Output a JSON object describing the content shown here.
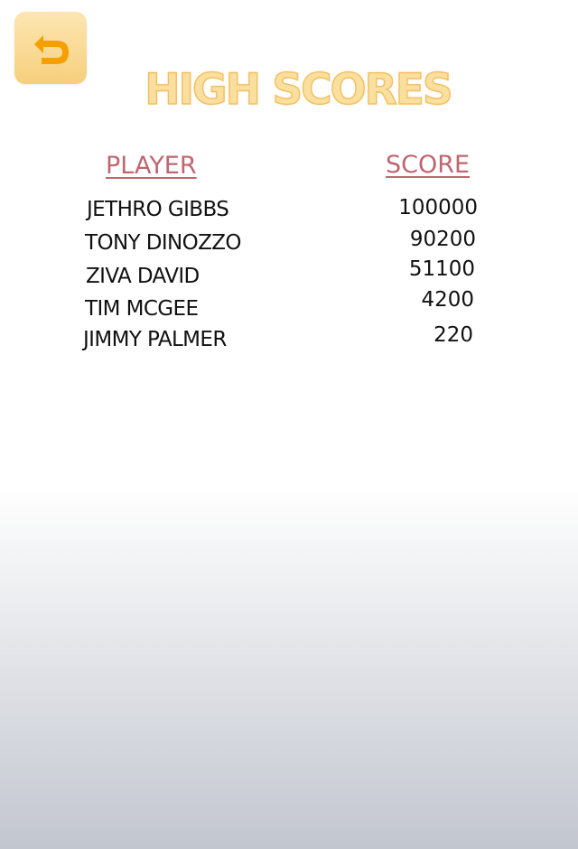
{
  "header": {
    "title": "HIGH SCORES",
    "back_icon": "undo-arrow-icon"
  },
  "table": {
    "headers": {
      "player": "PLAYER",
      "score": "SCORE"
    },
    "rows": [
      {
        "name": "JETHRO GIBBS",
        "score": "100000"
      },
      {
        "name": "TONY DINOZZO",
        "score": "90200"
      },
      {
        "name": "ZIVA DAVID",
        "score": "51100"
      },
      {
        "name": "TIM MCGEE",
        "score": "4200"
      },
      {
        "name": "JIMMY PALMER",
        "score": "220"
      }
    ]
  },
  "colors": {
    "title_fill": "#fadf9f",
    "title_outline": "#f2bf62",
    "header_color": "#bf6670",
    "back_button_bg": "#f6cf7c",
    "back_icon_color": "#f5a000"
  }
}
